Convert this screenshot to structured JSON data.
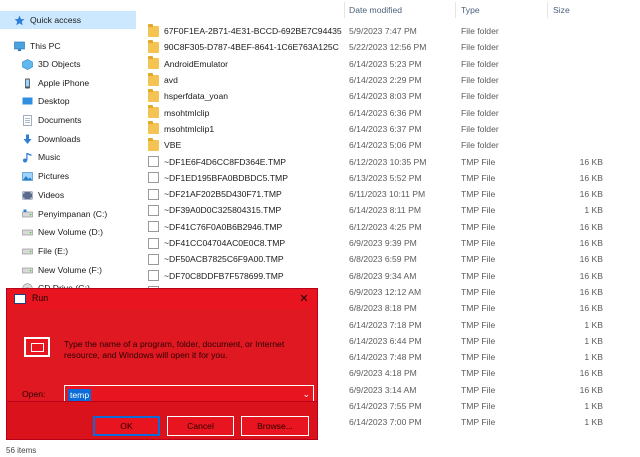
{
  "nav": {
    "items": [
      {
        "label": "Quick access",
        "icon": "star-icon",
        "selected": true
      },
      {
        "label": "This PC",
        "icon": "monitor-icon"
      },
      {
        "label": "3D Objects",
        "icon": "cube-icon"
      },
      {
        "label": "Apple iPhone",
        "icon": "phone-icon"
      },
      {
        "label": "Desktop",
        "icon": "desktop-icon"
      },
      {
        "label": "Documents",
        "icon": "document-icon"
      },
      {
        "label": "Downloads",
        "icon": "download-icon"
      },
      {
        "label": "Music",
        "icon": "music-icon"
      },
      {
        "label": "Pictures",
        "icon": "pictures-icon"
      },
      {
        "label": "Videos",
        "icon": "video-icon"
      },
      {
        "label": "Penyimpanan (C:)",
        "icon": "drive-icon"
      },
      {
        "label": "New Volume (D:)",
        "icon": "drive-icon"
      },
      {
        "label": "File (E:)",
        "icon": "drive-icon"
      },
      {
        "label": "New Volume (F:)",
        "icon": "drive-icon"
      },
      {
        "label": "CD Drive (G:)",
        "icon": "cd-icon"
      }
    ]
  },
  "columns": {
    "date": "Date modified",
    "type": "Type",
    "size": "Size"
  },
  "files": [
    {
      "name": "67F0F1EA-2B71-4E31-BCCD-692BE7C94435",
      "date": "5/9/2023 7:47 PM",
      "type": "File folder",
      "size": "",
      "kind": "folder"
    },
    {
      "name": "90C8F305-D787-4BEF-8641-1C6E763A125C",
      "date": "5/22/2023 12:56 PM",
      "type": "File folder",
      "size": "",
      "kind": "folder"
    },
    {
      "name": "AndroidEmulator",
      "date": "6/14/2023 5:23 PM",
      "type": "File folder",
      "size": "",
      "kind": "folder"
    },
    {
      "name": "avd",
      "date": "6/14/2023 2:29 PM",
      "type": "File folder",
      "size": "",
      "kind": "folder"
    },
    {
      "name": "hsperfdata_yoan",
      "date": "6/14/2023 8:03 PM",
      "type": "File folder",
      "size": "",
      "kind": "folder"
    },
    {
      "name": "msohtmlclip",
      "date": "6/14/2023 6:36 PM",
      "type": "File folder",
      "size": "",
      "kind": "folder"
    },
    {
      "name": "msohtmlclip1",
      "date": "6/14/2023 6:37 PM",
      "type": "File folder",
      "size": "",
      "kind": "folder"
    },
    {
      "name": "VBE",
      "date": "6/14/2023 5:06 PM",
      "type": "File folder",
      "size": "",
      "kind": "folder"
    },
    {
      "name": "~DF1E6F4D6CC8FD364E.TMP",
      "date": "6/12/2023 10:35 PM",
      "type": "TMP File",
      "size": "16 KB",
      "kind": "file"
    },
    {
      "name": "~DF1ED195BFA0BDBDC5.TMP",
      "date": "6/13/2023 5:52 PM",
      "type": "TMP File",
      "size": "16 KB",
      "kind": "file"
    },
    {
      "name": "~DF21AF202B5D430F71.TMP",
      "date": "6/11/2023 10:11 PM",
      "type": "TMP File",
      "size": "16 KB",
      "kind": "file"
    },
    {
      "name": "~DF39A0D0C325804315.TMP",
      "date": "6/14/2023 8:11 PM",
      "type": "TMP File",
      "size": "1 KB",
      "kind": "file"
    },
    {
      "name": "~DF41C76F0A0B6B2946.TMP",
      "date": "6/12/2023 4:25 PM",
      "type": "TMP File",
      "size": "16 KB",
      "kind": "file"
    },
    {
      "name": "~DF41CC04704AC0E0C8.TMP",
      "date": "6/9/2023 9:39 PM",
      "type": "TMP File",
      "size": "16 KB",
      "kind": "file"
    },
    {
      "name": "~DF50ACB7825C6F9A00.TMP",
      "date": "6/8/2023 6:59 PM",
      "type": "TMP File",
      "size": "16 KB",
      "kind": "file"
    },
    {
      "name": "~DF70C8DDFB7F578699.TMP",
      "date": "6/8/2023 9:34 AM",
      "type": "TMP File",
      "size": "16 KB",
      "kind": "file"
    },
    {
      "name": "",
      "date": "6/9/2023 12:12 AM",
      "type": "TMP File",
      "size": "16 KB",
      "kind": "file"
    },
    {
      "name": "",
      "date": "6/8/2023 8:18 PM",
      "type": "TMP File",
      "size": "16 KB",
      "kind": "file"
    },
    {
      "name": "",
      "date": "6/14/2023 7:18 PM",
      "type": "TMP File",
      "size": "1 KB",
      "kind": "file"
    },
    {
      "name": "",
      "date": "6/14/2023 6:44 PM",
      "type": "TMP File",
      "size": "1 KB",
      "kind": "file"
    },
    {
      "name": "",
      "date": "6/14/2023 7:48 PM",
      "type": "TMP File",
      "size": "1 KB",
      "kind": "file"
    },
    {
      "name": "...a9...",
      "date": "6/9/2023 4:18 PM",
      "type": "TMP File",
      "size": "16 KB",
      "kind": "file"
    },
    {
      "name": "...",
      "date": "6/9/2023 3:14 AM",
      "type": "TMP File",
      "size": "16 KB",
      "kind": "file"
    },
    {
      "name": "...42.t...",
      "date": "6/14/2023 7:55 PM",
      "type": "TMP File",
      "size": "1 KB",
      "kind": "file"
    },
    {
      "name": "...b...",
      "date": "6/14/2023 7:00 PM",
      "type": "TMP File",
      "size": "1 KB",
      "kind": "file"
    }
  ],
  "run_dialog": {
    "title": "Run",
    "description": "Type the name of a program, folder, document, or Internet resource, and Windows will open it for you.",
    "open_label": "Open:",
    "open_value": "temp",
    "ok_label": "OK",
    "cancel_label": "Cancel",
    "browse_label": "Browse...",
    "close_glyph": "✕",
    "accent_color": "#e8141f"
  },
  "status_bar": {
    "item_count": "56 items"
  }
}
